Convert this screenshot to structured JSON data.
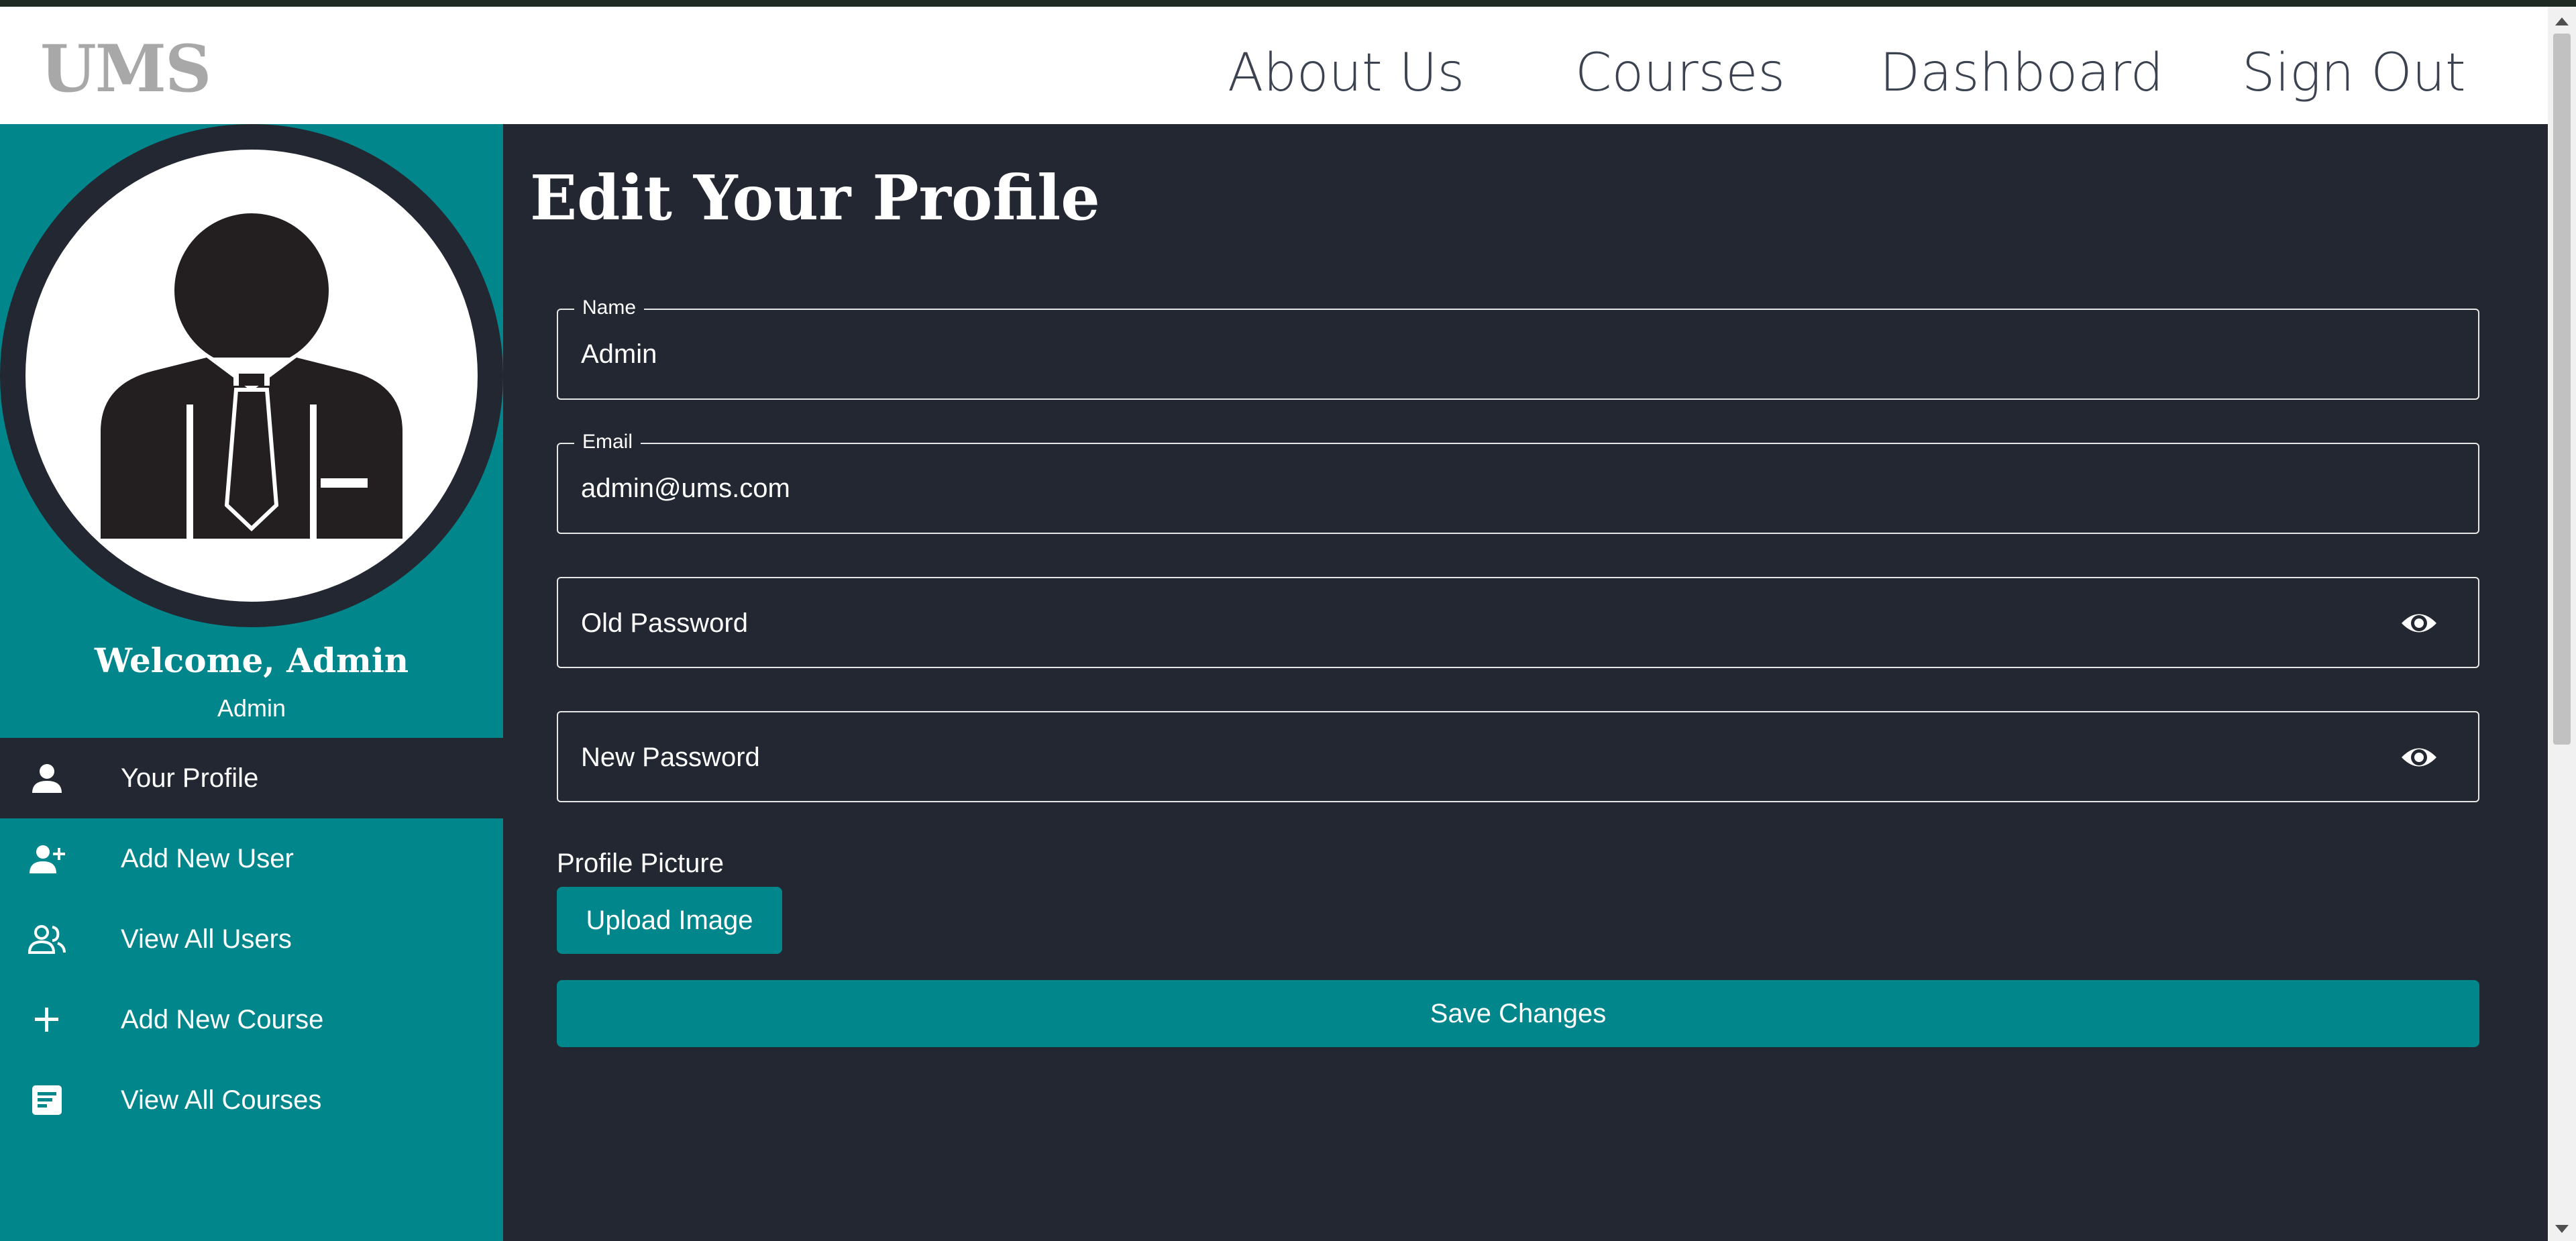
{
  "header": {
    "logo": "UMS",
    "nav": [
      "About Us",
      "Courses",
      "Dashboard",
      "Sign Out"
    ]
  },
  "sidebar": {
    "welcome": "Welcome, Admin",
    "role": "Admin",
    "items": [
      {
        "label": "Your Profile",
        "icon": "person-icon",
        "active": true
      },
      {
        "label": "Add New User",
        "icon": "person-add-icon",
        "active": false
      },
      {
        "label": "View All Users",
        "icon": "group-icon",
        "active": false
      },
      {
        "label": "Add New Course",
        "icon": "plus-icon",
        "active": false
      },
      {
        "label": "View All Courses",
        "icon": "notes-icon",
        "active": false
      }
    ]
  },
  "main": {
    "title": "Edit Your Profile",
    "fields": {
      "name": {
        "label": "Name",
        "value": "Admin"
      },
      "email": {
        "label": "Email",
        "value": "admin@ums.com"
      },
      "old_password": {
        "placeholder": "Old Password"
      },
      "new_password": {
        "placeholder": "New Password"
      }
    },
    "profile_picture_label": "Profile Picture",
    "upload_button": "Upload Image",
    "save_button": "Save Changes"
  },
  "colors": {
    "accent": "#00868b",
    "background": "#222731",
    "header": "#ffffff"
  }
}
